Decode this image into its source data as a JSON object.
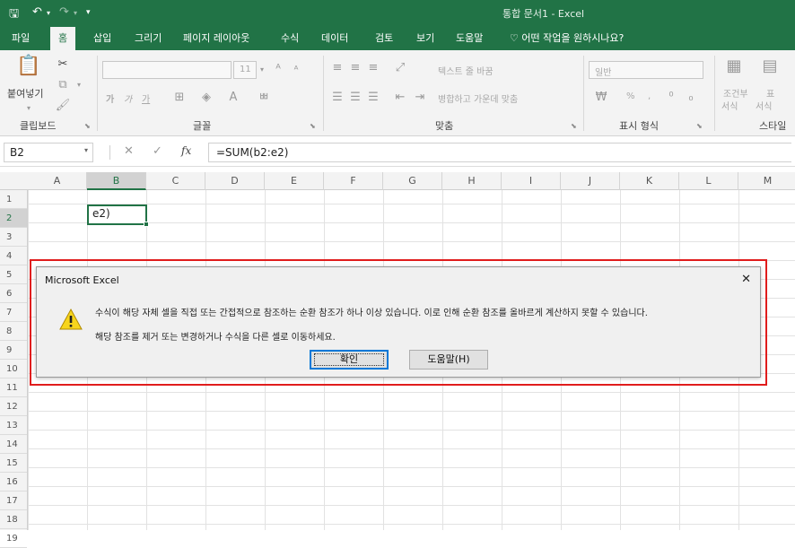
{
  "titlebar": {
    "document_title": "통합 문서1 - Excel"
  },
  "menu": {
    "file": "파일",
    "home": "홈",
    "insert": "삽입",
    "draw": "그리기",
    "page_layout": "페이지 레이아웃",
    "formulas": "수식",
    "data": "데이터",
    "review": "검토",
    "view": "보기",
    "help": "도움말",
    "tell_me": "어떤 작업을 원하시나요?"
  },
  "ribbon": {
    "clipboard": {
      "paste": "붙여넣기",
      "label": "클립보드"
    },
    "font": {
      "label": "글꼴",
      "size": "11",
      "bold": "가",
      "italic": "가",
      "underline": "가"
    },
    "alignment": {
      "wrap_text": "텍스트 줄 바꿈",
      "merge_center": "병합하고 가운데 맞춤",
      "label": "맞춤"
    },
    "number": {
      "format": "일반",
      "percent": "%",
      "comma": ",",
      "label": "표시 형식"
    },
    "styles": {
      "conditional": "조건부",
      "conditional2": "서식",
      "table": "표",
      "table2": "서식",
      "label": "스타일"
    }
  },
  "formula_bar": {
    "name_box": "B2",
    "fx": "fx",
    "formula": "=SUM(b2:e2)"
  },
  "sheet": {
    "columns": [
      "A",
      "B",
      "C",
      "D",
      "E",
      "F",
      "G",
      "H",
      "I",
      "J",
      "K",
      "L",
      "M"
    ],
    "rows": [
      "1",
      "2",
      "3",
      "4",
      "5",
      "6",
      "7",
      "8",
      "9",
      "10",
      "11",
      "12",
      "13",
      "14",
      "15",
      "16",
      "17",
      "18",
      "19"
    ],
    "selected_column": "B",
    "selected_row": "2",
    "active_cell_text": "e2)"
  },
  "dialog": {
    "title": "Microsoft Excel",
    "message_line1": "수식이 해당 자체 셀을 직접 또는 간접적으로 참조하는 순환 참조가 하나 이상 있습니다. 이로 인해 순환 참조를 올바르게 계산하지 못할 수 있습니다.",
    "message_line2": "해당 참조를 제거 또는 변경하거나 수식을 다른 셀로 이동하세요.",
    "ok_label": "확인",
    "help_label": "도움말(H)",
    "icon": "warning-icon",
    "highlight_color": "#e01c1c"
  },
  "colors": {
    "excel_green": "#217346"
  }
}
